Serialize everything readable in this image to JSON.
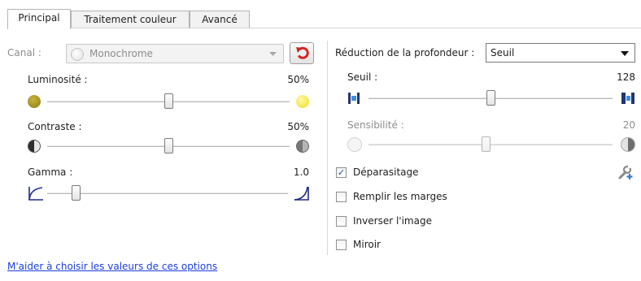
{
  "tabs": [
    {
      "label": "Principal",
      "active": true
    },
    {
      "label": "Traitement couleur",
      "active": false
    },
    {
      "label": "Avancé",
      "active": false
    }
  ],
  "left": {
    "channel_label": "Canal :",
    "channel_value": "Monochrome",
    "brightness": {
      "label": "Luminosité :",
      "value_text": "50%",
      "level": 0.5
    },
    "contrast": {
      "label": "Contraste :",
      "value_text": "50%",
      "level": 0.5
    },
    "gamma": {
      "label": "Gamma :",
      "value_text": "1.0",
      "level": 0.12
    }
  },
  "right": {
    "bit_depth_label": "Réduction de la profondeur :",
    "bit_depth_value": "Seuil",
    "threshold": {
      "label": "Seuil :",
      "value_text": "128",
      "level": 0.5
    },
    "sensitivity": {
      "label": "Sensibilité :",
      "value_text": "20",
      "level": 0.48,
      "enabled": false
    },
    "options": [
      {
        "label": "Déparasitage",
        "checked": true
      },
      {
        "label": "Remplir les marges",
        "checked": false
      },
      {
        "label": "Inverser l'image",
        "checked": false
      },
      {
        "label": "Miroir",
        "checked": false
      }
    ]
  },
  "help_link": "M'aider à choisir les valeurs de ces options",
  "icons": {
    "reset": "undo-arrow-icon",
    "settings": "wrench-plus-icon"
  },
  "colors": {
    "reset_arrow": "#d22525",
    "sun_dark": "#9a8a1f",
    "sun_bright": "#f2e43a",
    "link": "#1a3ee0"
  }
}
